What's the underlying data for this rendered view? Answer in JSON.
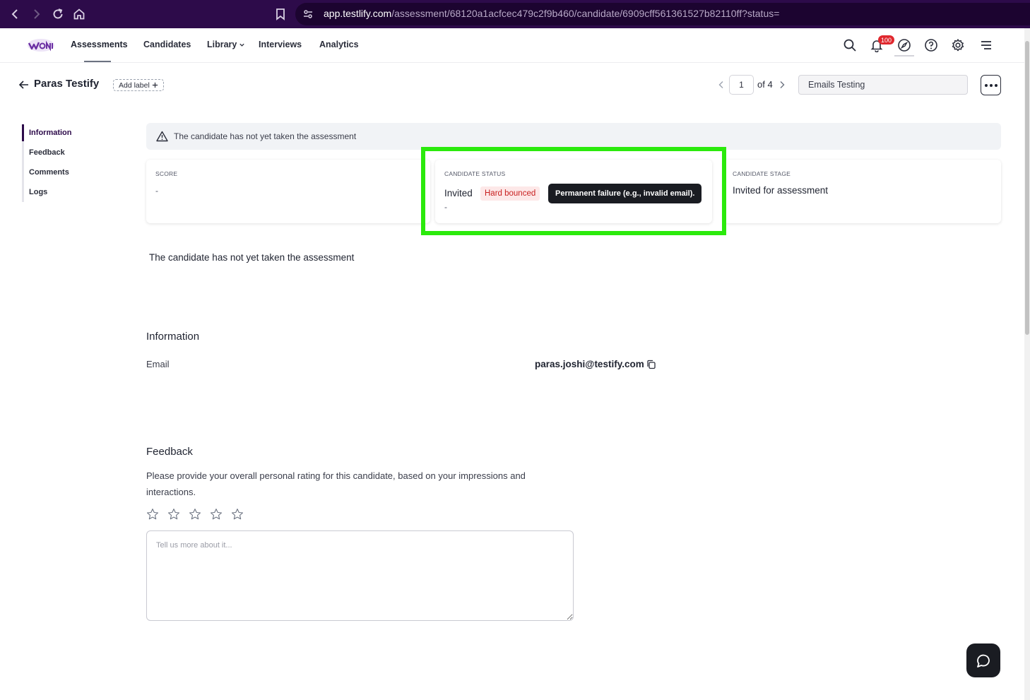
{
  "browser": {
    "url_host": "app.testlify.com",
    "url_path": "/assessment/68120a1acfcec479c2f9b460/candidate/6909cff561361527b82110ff?status="
  },
  "header": {
    "nav": [
      {
        "label": "Assessments"
      },
      {
        "label": "Candidates"
      },
      {
        "label": "Library"
      },
      {
        "label": "Interviews"
      },
      {
        "label": "Analytics"
      }
    ],
    "notification_count": "100"
  },
  "candidate": {
    "name": "Paras Testify",
    "add_label": "Add label",
    "pager_current": "1",
    "pager_total": "of 4",
    "assessment_name": "Emails Testing"
  },
  "side_nav": {
    "items": [
      {
        "label": "Information"
      },
      {
        "label": "Feedback"
      },
      {
        "label": "Comments"
      },
      {
        "label": "Logs"
      }
    ]
  },
  "alert": {
    "text": "The candidate has not yet taken the assessment"
  },
  "cards": {
    "score_label": "SCORE",
    "score_value": "-",
    "status_label": "CANDIDATE STATUS",
    "status_value": "Invited",
    "status_badge": "Hard bounced",
    "status_sub": "-",
    "tooltip": "Permanent failure (e.g., invalid email).",
    "stage_label": "CANDIDATE STAGE",
    "stage_value": "Invited for assessment"
  },
  "not_taken_text": "The candidate has not yet taken the assessment",
  "information": {
    "title": "Information",
    "email_label": "Email",
    "email_value": "paras.joshi@testify.com"
  },
  "feedback": {
    "title": "Feedback",
    "description": "Please provide your overall personal rating for this candidate, based on your impressions and interactions.",
    "rating": 0,
    "max_rating": 5,
    "placeholder": "Tell us more about it..."
  },
  "colors": {
    "brand": "#2d0b4a",
    "highlight": "#2bea0c",
    "badge_bg": "#fde8e8",
    "badge_text": "#c81e1e"
  }
}
